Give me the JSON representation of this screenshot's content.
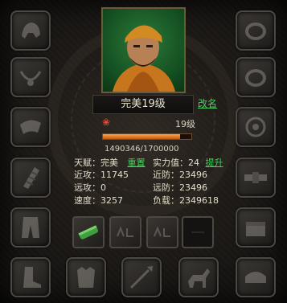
{
  "character": {
    "name_level": "完美19级",
    "rename_label": "改名",
    "level_label": "19级",
    "exp_text": "1490346/1700000",
    "exp_fraction": 0.877
  },
  "stats": {
    "talent_label": "天赋：",
    "talent_value": "完美",
    "reset_label": "重置",
    "power_label": "实力值：",
    "power_value": "24",
    "upgrade_label": "提升",
    "melee_atk_label": "近攻：",
    "melee_atk_value": "11745",
    "melee_def_label": "近防：",
    "melee_def_value": "23496",
    "ranged_atk_label": "远攻：",
    "ranged_atk_value": "0",
    "ranged_def_label": "远防：",
    "ranged_def_value": "23496",
    "speed_label": "速度：",
    "speed_value": "3257",
    "load_label": "负载：",
    "load_value": "2349618"
  },
  "equipment_icons": {
    "left": [
      "helmet-icon",
      "necklace-icon",
      "shoulder-icon",
      "bracer-icon",
      "pants-icon"
    ],
    "right": [
      "ring-icon",
      "ring-icon",
      "bracelet-icon",
      "belt-icon",
      "chest-icon"
    ],
    "bottom": [
      "boots-icon",
      "armor-icon",
      "spear-icon",
      "horse-icon",
      "saddle-icon"
    ],
    "middle": [
      "scroll-icon",
      "empty-slot-icon",
      "empty-slot-icon",
      "empty-slot-icon"
    ]
  },
  "colors": {
    "link": "#3fd35a",
    "exp_fill": "#ffa64a",
    "text": "#e4ddca"
  }
}
